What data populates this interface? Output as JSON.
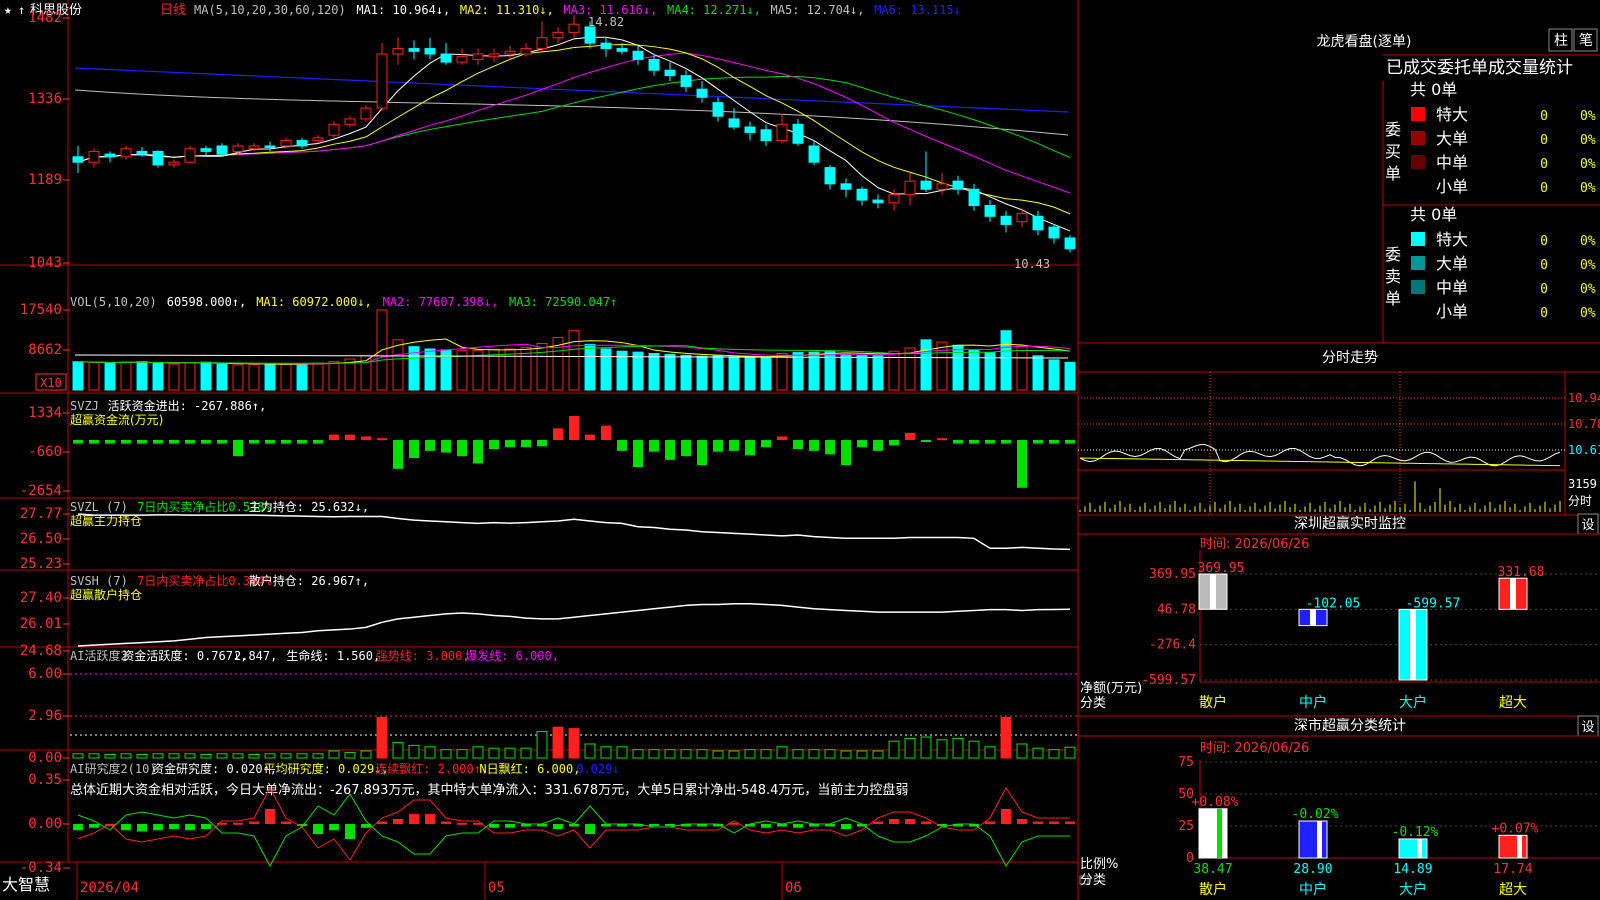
{
  "app": {
    "brand": "大智慧",
    "stock": "科思股份",
    "period": "日线"
  },
  "colors": {
    "up": "#ff2020",
    "down": "#00ffff",
    "green": "#00e000",
    "grid": "#c00000",
    "ma1": "#ffffff",
    "ma2": "#ffff00",
    "ma3": "#ff00ff",
    "ma4": "#00dd00",
    "ma5": "#c0c0c0",
    "ma6": "#2020ff"
  },
  "main_chart": {
    "legend": [
      {
        "text": "MA(5,10,20,30,60,120)",
        "color": "#c0c0c0"
      },
      {
        "text": "MA1: 10.964↓,",
        "color": "#ffffff"
      },
      {
        "text": "MA2: 11.310↓,",
        "color": "#ffff00"
      },
      {
        "text": "MA3: 11.616↓,",
        "color": "#ff00ff"
      },
      {
        "text": "MA4: 12.271↓,",
        "color": "#00dd00"
      },
      {
        "text": "MA5: 12.704↓,",
        "color": "#c0c0c0"
      },
      {
        "text": "MA6: 13.115↓",
        "color": "#2020ff"
      }
    ],
    "y_ticks": [
      "1482",
      "1336",
      "1189",
      "1043"
    ],
    "high_label": "14.82",
    "low_label": "10.43"
  },
  "vol_panel": {
    "legend": [
      {
        "text": "VOL(5,10,20)",
        "color": "#c0c0c0"
      },
      {
        "text": "60598.000↑,",
        "color": "#ffffff"
      },
      {
        "text": "MA1: 60972.000↓,",
        "color": "#ffff00"
      },
      {
        "text": "MA2: 77607.398↓,",
        "color": "#ff00ff"
      },
      {
        "text": "MA3: 72590.047↑",
        "color": "#00dd00"
      }
    ],
    "y_ticks": [
      "17540",
      "8662"
    ],
    "unit": "X10"
  },
  "svzj_panel": {
    "legend": [
      {
        "text": "SVZJ",
        "color": "#c0c0c0"
      },
      {
        "text": "活跃资金进出: -267.886↑,",
        "color": "#ffffff"
      }
    ],
    "title": "超赢资金流(万元)",
    "y_ticks": [
      "1334",
      "-660",
      "-2654"
    ]
  },
  "svzl_panel": {
    "legend": [
      {
        "text": "SVZL (7)",
        "color": "#c0c0c0"
      },
      {
        "text": "7日内买卖净占比0.538%",
        "color": "#00e000"
      },
      {
        "text": "主力持仓: 25.632↓,",
        "color": "#ffffff"
      }
    ],
    "title": "超赢主力持仓",
    "y_ticks": [
      "27.77",
      "26.50",
      "25.23"
    ]
  },
  "svsh_panel": {
    "legend": [
      {
        "text": "SVSH (7)",
        "color": "#c0c0c0"
      },
      {
        "text": "7日内买卖净占比0.344%",
        "color": "#ff2020"
      },
      {
        "text": "散户持仓: 26.967↑,",
        "color": "#ffffff"
      }
    ],
    "title": "超赢散户持仓",
    "y_ticks": [
      "27.40",
      "26.01",
      "24.68"
    ]
  },
  "ai_active_panel": {
    "legend": [
      {
        "text": "AI活跃度2",
        "color": "#c0c0c0"
      },
      {
        "text": "资金活跃度: 0.767↓,",
        "color": "#ffffff"
      },
      {
        "text": "2.847,",
        "color": "#ffffff"
      },
      {
        "text": "生命线: 1.560,",
        "color": "#ffffff"
      },
      {
        "text": "强势线: 3.000,",
        "color": "#ff2020"
      },
      {
        "text": "爆发线: 6.000,",
        "color": "#ff00ff"
      }
    ],
    "y_ticks": [
      "6.00",
      "2.96",
      "0.00"
    ]
  },
  "ai_research_panel": {
    "legend": [
      {
        "text": "AI研究度2(10)",
        "color": "#c0c0c0"
      },
      {
        "text": "资金研究度: 0.020↑,",
        "color": "#ffffff"
      },
      {
        "text": "平均研究度: 0.029↓,",
        "color": "#ffff00"
      },
      {
        "text": "连续飘红: 2.000↑,",
        "color": "#ff2020"
      },
      {
        "text": "N日飘红: 6.000,",
        "color": "#ffff00"
      },
      {
        "text": "0.029↓",
        "color": "#2020ff"
      }
    ],
    "summary": "总体近期大资金相对活跃，今日大单净流出：-267.893万元，其中特大单净流入：331.678万元，大单5日累计净出-548.4万元，当前主力控盘弱",
    "y_ticks": [
      "0.35",
      "0.00",
      "-0.34"
    ]
  },
  "x_axis": {
    "labels": [
      "2026/04",
      "05",
      "06"
    ]
  },
  "right_panel": {
    "tabs": [
      "柱",
      "笔"
    ],
    "title": "龙虎看盘(逐单)",
    "subtitle": "已成交委托单成交量统计",
    "buy": {
      "label": "委买单",
      "total": "共 0单",
      "rows": [
        {
          "name": "特大",
          "color": "#ff0000",
          "count": "0",
          "pct": "0%"
        },
        {
          "name": "大单",
          "color": "#990000",
          "count": "0",
          "pct": "0%"
        },
        {
          "name": "中单",
          "color": "#660000",
          "count": "0",
          "pct": "0%"
        },
        {
          "name": "小单",
          "color": "#000000",
          "count": "0",
          "pct": "0%"
        }
      ]
    },
    "sell": {
      "label": "委卖单",
      "total": "共 0单",
      "rows": [
        {
          "name": "特大",
          "color": "#00ffff",
          "count": "0",
          "pct": "0%"
        },
        {
          "name": "大单",
          "color": "#009999",
          "count": "0",
          "pct": "0%"
        },
        {
          "name": "中单",
          "color": "#007777",
          "count": "0",
          "pct": "0%"
        },
        {
          "name": "小单",
          "color": "#000000",
          "count": "0",
          "pct": "0%"
        }
      ]
    },
    "intraday": {
      "title": "分时走势",
      "y_ticks": [
        "10.94",
        "10.78",
        "10.61"
      ],
      "vol_tick": "3159",
      "vol_label": "分时"
    },
    "monitor": {
      "title": "深圳超赢实时监控",
      "settings": "设",
      "time": "时间: 2026/06/26",
      "y_ticks": [
        "369.95",
        "46.78",
        "-276.4",
        "-599.57"
      ],
      "axis_label": "净额(万元)",
      "axis_label2": "分类",
      "bars": [
        {
          "cat": "散户",
          "value": 369.95,
          "label": "369.95"
        },
        {
          "cat": "中户",
          "value": -102.05,
          "label": "-102.05"
        },
        {
          "cat": "大户",
          "value": -599.57,
          "label": "-599.57"
        },
        {
          "cat": "超大",
          "value": 331.68,
          "label": "331.68"
        }
      ]
    },
    "stats": {
      "title": "深市超赢分类统计",
      "settings": "设",
      "time": "时间: 2026/06/26",
      "y_ticks": [
        "75",
        "50",
        "25",
        "0"
      ],
      "axis_label": "比例%",
      "axis_label2": "分类",
      "bars": [
        {
          "cat": "散户",
          "value": 38.47,
          "label": "38.47",
          "delta": "+0.08%"
        },
        {
          "cat": "中户",
          "value": 28.9,
          "label": "28.90",
          "delta": "-0.02%"
        },
        {
          "cat": "大户",
          "value": 14.89,
          "label": "14.89",
          "delta": "-0.12%"
        },
        {
          "cat": "超大",
          "value": 17.74,
          "label": "17.74",
          "delta": "+0.07%"
        }
      ]
    }
  },
  "candles": [
    [
      12.2,
      12.1,
      12.4,
      11.9
    ],
    [
      12.1,
      12.3,
      12.35,
      12.0
    ],
    [
      12.25,
      12.2,
      12.3,
      12.1
    ],
    [
      12.2,
      12.35,
      12.4,
      12.15
    ],
    [
      12.3,
      12.25,
      12.38,
      12.2
    ],
    [
      12.3,
      12.05,
      12.32,
      12.0
    ],
    [
      12.05,
      12.1,
      12.15,
      12.0
    ],
    [
      12.1,
      12.35,
      12.4,
      12.08
    ],
    [
      12.35,
      12.3,
      12.4,
      12.22
    ],
    [
      12.4,
      12.25,
      12.45,
      12.2
    ],
    [
      12.3,
      12.4,
      12.45,
      12.25
    ],
    [
      12.35,
      12.4,
      12.45,
      12.3
    ],
    [
      12.4,
      12.38,
      12.48,
      12.3
    ],
    [
      12.4,
      12.5,
      12.55,
      12.35
    ],
    [
      12.5,
      12.4,
      12.55,
      12.35
    ],
    [
      12.5,
      12.55,
      12.6,
      12.45
    ],
    [
      12.6,
      12.8,
      12.85,
      12.55
    ],
    [
      12.8,
      12.9,
      12.95,
      12.75
    ],
    [
      12.9,
      13.1,
      13.15,
      12.85
    ],
    [
      13.1,
      14.1,
      14.3,
      13.05
    ],
    [
      14.1,
      14.2,
      14.4,
      13.9
    ],
    [
      14.2,
      14.15,
      14.35,
      14.0
    ],
    [
      14.2,
      14.1,
      14.4,
      14.0
    ],
    [
      14.1,
      13.95,
      14.3,
      13.9
    ],
    [
      13.95,
      14.05,
      14.2,
      13.9
    ],
    [
      14.0,
      14.1,
      14.2,
      13.9
    ],
    [
      14.05,
      14.1,
      14.2,
      13.95
    ],
    [
      14.1,
      14.15,
      14.25,
      14.0
    ],
    [
      14.1,
      14.2,
      14.3,
      14.05
    ],
    [
      14.2,
      14.4,
      14.7,
      14.15
    ],
    [
      14.4,
      14.5,
      14.6,
      14.3
    ],
    [
      14.5,
      14.65,
      14.82,
      14.4
    ],
    [
      14.6,
      14.3,
      14.7,
      14.2
    ],
    [
      14.3,
      14.2,
      14.4,
      14.05
    ],
    [
      14.2,
      14.15,
      14.3,
      14.1
    ],
    [
      14.15,
      14.0,
      14.25,
      13.9
    ],
    [
      14.0,
      13.8,
      14.1,
      13.7
    ],
    [
      13.8,
      13.7,
      13.95,
      13.6
    ],
    [
      13.7,
      13.5,
      13.8,
      13.4
    ],
    [
      13.45,
      13.3,
      13.6,
      13.2
    ],
    [
      13.2,
      12.95,
      13.3,
      12.85
    ],
    [
      12.9,
      12.75,
      13.1,
      12.7
    ],
    [
      12.75,
      12.65,
      12.85,
      12.5
    ],
    [
      12.7,
      12.5,
      12.8,
      12.4
    ],
    [
      12.5,
      12.8,
      13.0,
      12.45
    ],
    [
      12.8,
      12.45,
      12.9,
      12.4
    ],
    [
      12.4,
      12.1,
      12.5,
      12.05
    ],
    [
      12.0,
      11.7,
      12.05,
      11.6
    ],
    [
      11.7,
      11.6,
      11.8,
      11.45
    ],
    [
      11.6,
      11.4,
      11.65,
      11.3
    ],
    [
      11.4,
      11.35,
      11.5,
      11.25
    ],
    [
      11.35,
      11.5,
      11.6,
      11.2
    ],
    [
      11.5,
      11.75,
      11.9,
      11.3
    ],
    [
      11.75,
      11.6,
      12.3,
      11.55
    ],
    [
      11.6,
      11.7,
      11.9,
      11.5
    ],
    [
      11.75,
      11.6,
      11.85,
      11.5
    ],
    [
      11.6,
      11.3,
      11.7,
      11.2
    ],
    [
      11.3,
      11.1,
      11.4,
      11.0
    ],
    [
      11.1,
      10.95,
      11.2,
      10.8
    ],
    [
      11.0,
      11.15,
      11.25,
      10.9
    ],
    [
      11.1,
      10.85,
      11.2,
      10.75
    ],
    [
      10.9,
      10.7,
      10.95,
      10.6
    ],
    [
      10.7,
      10.5,
      10.75,
      10.43
    ]
  ],
  "volumes": [
    6200,
    6000,
    5900,
    6100,
    6200,
    5800,
    5700,
    6000,
    6100,
    5600,
    5500,
    5600,
    5700,
    5800,
    5600,
    5900,
    6200,
    6800,
    7500,
    17540,
    11000,
    9500,
    9000,
    8800,
    8600,
    8700,
    8900,
    9000,
    9300,
    10200,
    11500,
    13000,
    10000,
    9000,
    8500,
    8300,
    8000,
    7800,
    7600,
    7400,
    7500,
    7300,
    7200,
    7100,
    8000,
    8200,
    8300,
    8400,
    7800,
    7600,
    7500,
    8500,
    9200,
    11000,
    10500,
    9800,
    8700,
    8200,
    13000,
    9600,
    7500,
    6600,
    6060
  ],
  "svzj": [
    -200,
    -200,
    -200,
    -200,
    -200,
    -200,
    -200,
    -200,
    -200,
    -200,
    -900,
    -200,
    -200,
    -200,
    -200,
    -200,
    300,
    300,
    200,
    100,
    -1600,
    -1000,
    -600,
    -700,
    -900,
    -1300,
    -500,
    -400,
    -400,
    -350,
    650,
    1334,
    300,
    800,
    -600,
    -1500,
    -650,
    -1100,
    -900,
    -1400,
    -650,
    -600,
    -850,
    -400,
    200,
    -500,
    -600,
    -800,
    -1400,
    -400,
    -600,
    -300,
    400,
    -100,
    100,
    -200,
    -200,
    -200,
    -200,
    -2654,
    -200,
    -200,
    -200,
    -268
  ],
  "svzl": [
    27.77,
    27.7,
    27.7,
    27.7,
    27.7,
    27.72,
    27.72,
    27.7,
    27.7,
    27.7,
    27.7,
    27.7,
    27.68,
    27.66,
    27.64,
    27.62,
    27.6,
    27.62,
    27.62,
    27.62,
    27.5,
    27.4,
    27.35,
    27.3,
    27.25,
    27.2,
    27.25,
    27.22,
    27.25,
    27.3,
    27.35,
    27.45,
    27.35,
    27.25,
    27.2,
    27.0,
    26.95,
    26.85,
    26.8,
    26.7,
    26.65,
    26.6,
    26.55,
    26.5,
    26.45,
    26.5,
    26.4,
    26.35,
    26.3,
    26.3,
    26.3,
    26.3,
    26.35,
    26.35,
    26.35,
    26.35,
    26.3,
    25.7,
    25.7,
    25.75,
    25.7,
    25.65,
    25.63
  ],
  "svsh": [
    24.8,
    24.85,
    24.9,
    24.95,
    25.0,
    25.05,
    25.1,
    25.2,
    25.3,
    25.35,
    25.4,
    25.45,
    25.5,
    25.55,
    25.6,
    25.7,
    25.75,
    25.8,
    25.9,
    26.2,
    26.4,
    26.5,
    26.6,
    26.7,
    26.75,
    26.7,
    26.6,
    26.55,
    26.45,
    26.4,
    26.4,
    26.5,
    26.6,
    26.7,
    26.8,
    26.9,
    27.0,
    27.1,
    27.2,
    27.25,
    27.25,
    27.3,
    27.3,
    27.25,
    27.2,
    27.1,
    27.0,
    26.95,
    26.9,
    26.85,
    26.8,
    26.8,
    26.8,
    26.8,
    26.8,
    26.85,
    26.9,
    26.95,
    26.95,
    26.9,
    26.95,
    26.96,
    26.97
  ],
  "ai_active": [
    0.3,
    0.3,
    0.25,
    0.3,
    0.25,
    0.3,
    0.3,
    0.3,
    0.25,
    0.3,
    0.3,
    0.25,
    0.3,
    0.3,
    0.3,
    0.3,
    0.5,
    0.4,
    0.5,
    2.9,
    1.1,
    0.9,
    0.8,
    0.6,
    0.6,
    0.8,
    0.7,
    0.7,
    0.7,
    1.9,
    2.2,
    2.1,
    1.0,
    0.8,
    0.8,
    0.6,
    0.6,
    0.6,
    0.6,
    0.6,
    0.5,
    0.5,
    0.6,
    0.6,
    0.8,
    0.6,
    0.6,
    0.6,
    0.5,
    0.5,
    0.5,
    1.2,
    1.4,
    1.5,
    1.3,
    1.4,
    1.2,
    0.8,
    2.9,
    1.0,
    0.7,
    0.6,
    0.77
  ],
  "ai_research": [
    -0.05,
    -0.03,
    0.0,
    -0.05,
    -0.06,
    -0.05,
    -0.04,
    -0.05,
    -0.04,
    0.01,
    0.01,
    0.02,
    0.12,
    0.02,
    -0.01,
    -0.08,
    -0.05,
    -0.12,
    -0.03,
    0.02,
    0.04,
    0.08,
    0.08,
    0.02,
    0.01,
    0.01,
    -0.03,
    -0.03,
    -0.02,
    -0.02,
    -0.04,
    -0.02,
    -0.08,
    -0.02,
    -0.02,
    -0.02,
    -0.01,
    -0.01,
    -0.02,
    -0.02,
    -0.02,
    0.01,
    -0.02,
    -0.03,
    -0.02,
    -0.03,
    -0.02,
    -0.02,
    -0.04,
    -0.02,
    0.02,
    0.04,
    0.04,
    0.02,
    -0.01,
    -0.02,
    -0.02,
    0.02,
    0.12,
    0.04,
    0.02,
    0.02,
    0.02
  ]
}
